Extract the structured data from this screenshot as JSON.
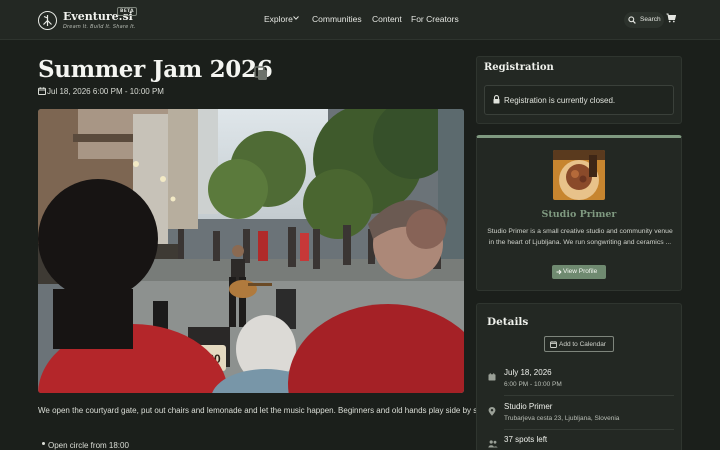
{
  "nav": {
    "brand": "Eventure.si",
    "tagline": "Dream It. Build It. Share It.",
    "beta": "BETA",
    "links": [
      "Explore",
      "Communities",
      "Content",
      "For Creators"
    ],
    "search_label": "Search",
    "icons": [
      "logo-icon",
      "chevron-down-icon",
      "search-icon",
      "cart-icon"
    ]
  },
  "event": {
    "title": "Summer Jam 2026",
    "datetime": "Jul 18, 2026 6:00 PM - 10:00 PM",
    "description": "We open the courtyard gate, put out chairs and lemonade and let the music happen. Beginners and old hands play side by side.",
    "bullets": [
      "Open circle from 18:00"
    ],
    "hero_sign": "CD$20"
  },
  "registration": {
    "title": "Registration",
    "message": "Registration is currently closed."
  },
  "host": {
    "name": "Studio Primer",
    "description": "Studio Primer is a small creative studio and community venue in the heart of Ljubljana. We run songwriting and ceramics ...",
    "button": "View Profile"
  },
  "details": {
    "title": "Details",
    "calendar_button": "Add to Calendar",
    "date": "July 18, 2026",
    "time": "6:00 PM - 10:00 PM",
    "venue": "Studio Primer",
    "address": "Trubarjeva cesta 23, Ljubljana, Slovenia",
    "spots": "37 spots left"
  },
  "colors": {
    "background": "#1b1f1b",
    "card": "#232823",
    "accent": "#7f9980",
    "button": "#6f8a70"
  }
}
